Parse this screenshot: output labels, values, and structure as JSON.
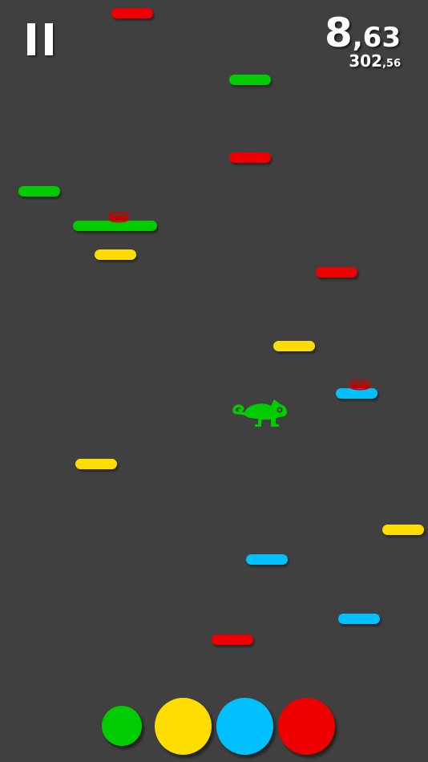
{
  "hud": {
    "score_whole": "8",
    "score_decimal": ",63",
    "best_whole": "302",
    "best_decimal": ",56",
    "pause_icon": "pause-icon"
  },
  "colors": {
    "green": "#00cc00",
    "yellow": "#ffdd00",
    "cyan": "#00c0ff",
    "red": "#ee0000",
    "background": "#404040"
  },
  "platforms": [
    {
      "color": "red"
    },
    {
      "color": "green"
    },
    {
      "color": "red"
    },
    {
      "color": "green"
    },
    {
      "color": "green",
      "spring": true
    },
    {
      "color": "yellow"
    },
    {
      "color": "red"
    },
    {
      "color": "yellow"
    },
    {
      "color": "cyan",
      "spring": true
    },
    {
      "color": "yellow"
    },
    {
      "color": "yellow"
    },
    {
      "color": "cyan"
    },
    {
      "color": "cyan"
    },
    {
      "color": "red"
    }
  ],
  "player": {
    "icon": "chameleon-icon",
    "color": "green"
  },
  "color_buttons": [
    {
      "color": "green",
      "selected": false
    },
    {
      "color": "yellow",
      "selected": false
    },
    {
      "color": "cyan",
      "selected": false
    },
    {
      "color": "red",
      "selected": false
    }
  ]
}
